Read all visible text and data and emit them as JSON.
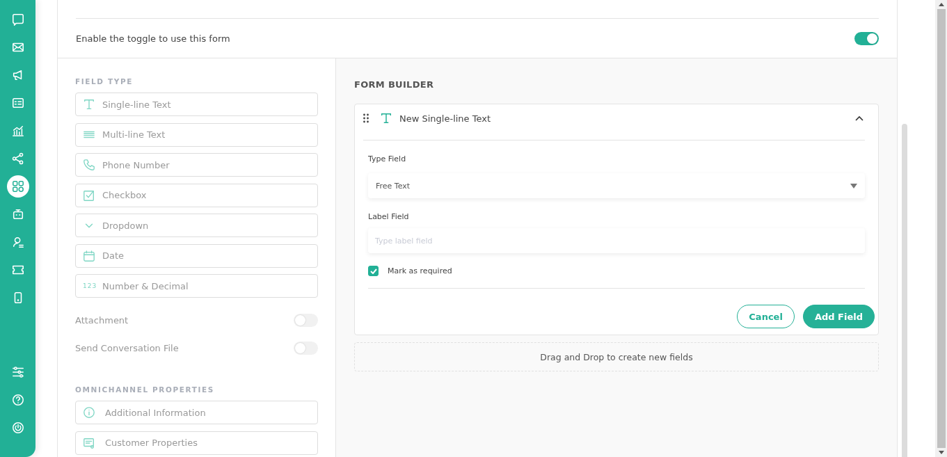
{
  "nav": [
    {
      "selected": false
    },
    {
      "selected": false
    },
    {
      "selected": false
    },
    {
      "selected": false
    },
    {
      "selected": false
    },
    {
      "selected": false
    },
    {
      "selected": true
    },
    {
      "selected": false
    },
    {
      "selected": false
    },
    {
      "selected": false
    },
    {
      "selected": false
    }
  ],
  "nav_bottom": [
    {
      "selected": false
    },
    {
      "selected": false
    },
    {
      "selected": false
    }
  ],
  "form_toggle": {
    "label": "Enable the toggle to use this form",
    "on": true
  },
  "field_type": {
    "title": "FIELD TYPE",
    "items": [
      {
        "label": "Single-line Text"
      },
      {
        "label": "Multi-line Text"
      },
      {
        "label": "Phone Number"
      },
      {
        "label": "Checkbox"
      },
      {
        "label": "Dropdown"
      },
      {
        "label": "Date"
      },
      {
        "label": "Number & Decimal",
        "icon_text": "123"
      }
    ]
  },
  "switches": [
    {
      "label": "Attachment",
      "on": false
    },
    {
      "label": "Send Conversation File",
      "on": false
    }
  ],
  "omnichannel": {
    "title": "OMNICHANNEL PROPERTIES",
    "items": [
      {
        "label": "Additional Information"
      },
      {
        "label": "Customer Properties"
      }
    ]
  },
  "form_builder": {
    "title": "FORM BUILDER",
    "field": {
      "title": "New Single-line Text",
      "expanded": true,
      "type_label": "Type Field",
      "type_value": "Free Text",
      "label_label": "Label Field",
      "label_placeholder": "Type label field",
      "required": {
        "label": "Mark as required",
        "checked": true
      },
      "cancel": "Cancel",
      "add": "Add Field"
    },
    "drop_hint": "Drag and Drop to create new fields"
  }
}
